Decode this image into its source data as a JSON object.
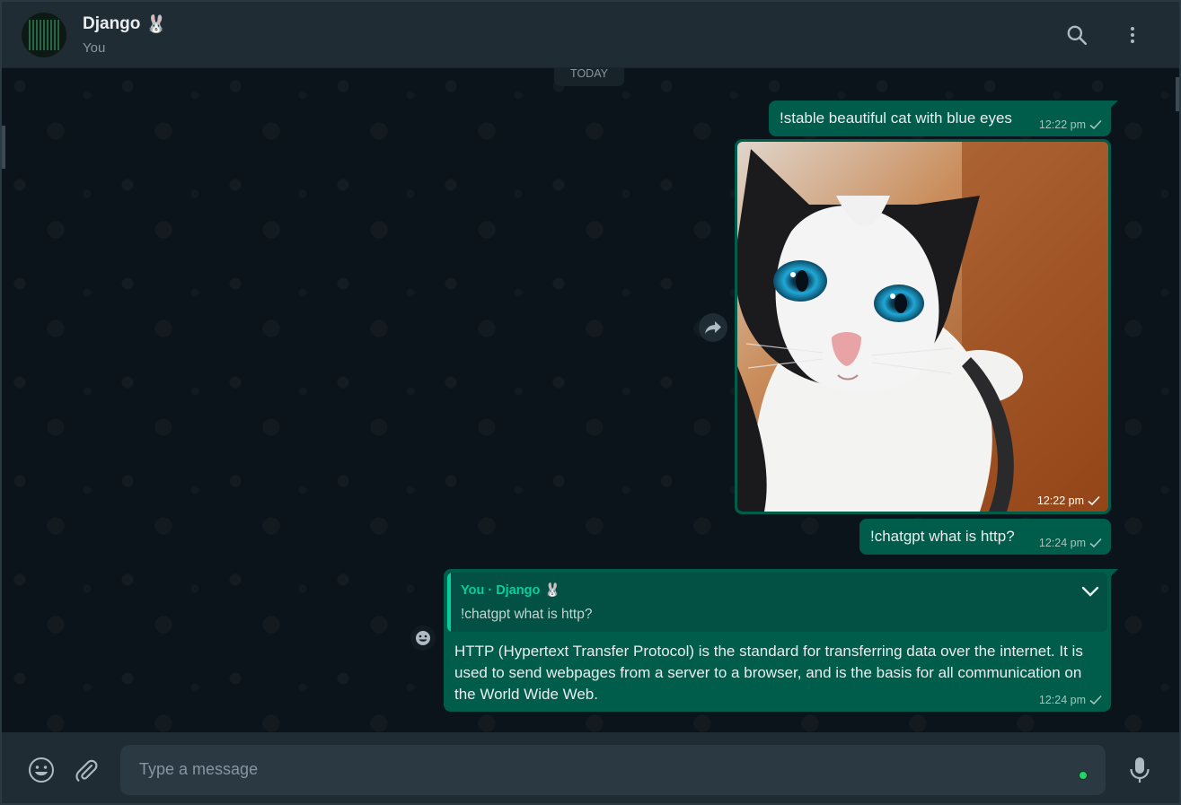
{
  "header": {
    "contact_name": "Django",
    "contact_emoji": "🐰",
    "subtitle": "You"
  },
  "chat": {
    "date_chip": "TODAY",
    "messages": [
      {
        "text": "!stable beautiful cat with blue eyes",
        "time": "12:22 pm"
      },
      {
        "type": "image",
        "time": "12:22 pm"
      },
      {
        "text": "!chatgpt what is http?",
        "time": "12:24 pm"
      },
      {
        "quote_name": "You · Django",
        "quote_emoji": "🐰",
        "quote_text": "!chatgpt what is http?",
        "text": "HTTP (Hypertext Transfer Protocol) is the standard for transferring data over the internet. It is used to send webpages from a server to a browser, and is the basis for all communication on the World Wide Web.",
        "time": "12:24 pm"
      }
    ]
  },
  "composer": {
    "placeholder": "Type a message"
  },
  "colors": {
    "header_bg": "#202c33",
    "chat_bg": "#0b141a",
    "outgoing_bubble": "#005c4b",
    "accent": "#06cf9c"
  },
  "icons": [
    "search-icon",
    "menu-dots-icon",
    "forward-icon",
    "emoji-icon",
    "attach-icon",
    "mic-icon",
    "chevron-down-icon",
    "check-icon"
  ]
}
